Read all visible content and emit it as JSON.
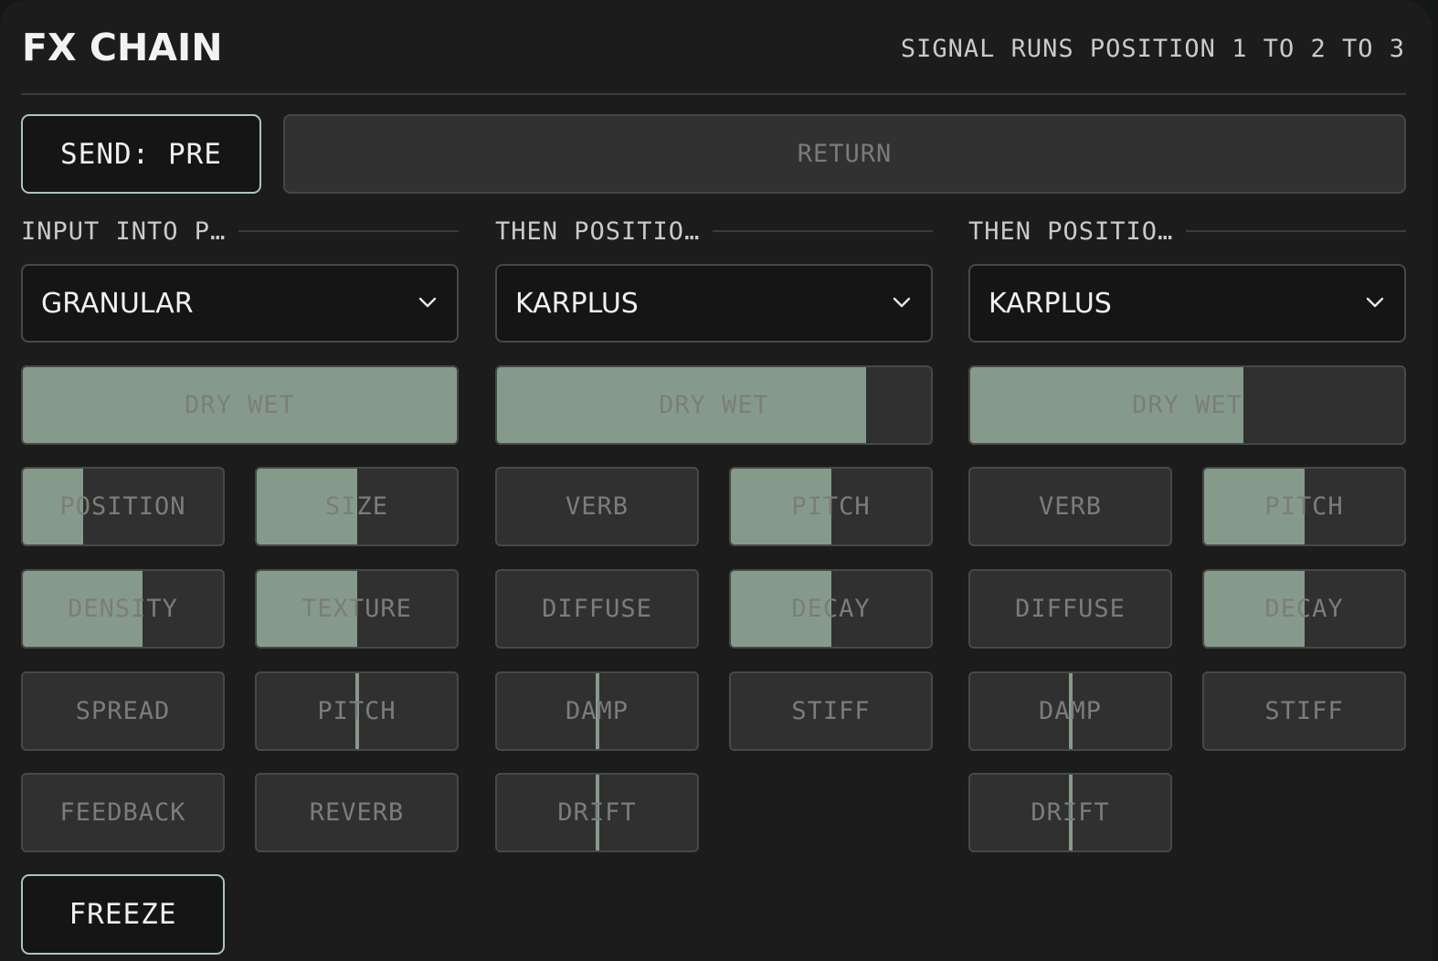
{
  "header": {
    "title": "FX CHAIN",
    "subtitle": "SIGNAL RUNS POSITION 1 TO 2 TO 3"
  },
  "send": {
    "label": "SEND: PRE"
  },
  "return": {
    "label": "RETURN"
  },
  "columns": [
    {
      "header": "INPUT INTO P…",
      "engine": "GRANULAR",
      "drywet": {
        "label": "DRY WET",
        "value": 1.0
      },
      "params": [
        {
          "label": "POSITION",
          "value": 0.3,
          "style": "fill"
        },
        {
          "label": "SIZE",
          "value": 0.5,
          "style": "fill"
        },
        {
          "label": "DENSITY",
          "value": 0.6,
          "style": "fill"
        },
        {
          "label": "TEXTURE",
          "value": 0.5,
          "style": "fill"
        },
        {
          "label": "SPREAD",
          "value": 0.0,
          "style": "fill"
        },
        {
          "label": "PITCH",
          "value": 0.5,
          "style": "center"
        },
        {
          "label": "FEEDBACK",
          "value": 0.0,
          "style": "fill"
        },
        {
          "label": "REVERB",
          "value": 0.0,
          "style": "fill"
        }
      ]
    },
    {
      "header": "THEN POSITIO…",
      "engine": "KARPLUS",
      "drywet": {
        "label": "DRY WET",
        "value": 0.85
      },
      "params": [
        {
          "label": "VERB",
          "value": 0.0,
          "style": "fill"
        },
        {
          "label": "PITCH",
          "value": 0.5,
          "style": "fill"
        },
        {
          "label": "DIFFUSE",
          "value": 0.0,
          "style": "fill"
        },
        {
          "label": "DECAY",
          "value": 0.5,
          "style": "fill"
        },
        {
          "label": "DAMP",
          "value": 0.5,
          "style": "center"
        },
        {
          "label": "STIFF",
          "value": 0.0,
          "style": "fill"
        },
        {
          "label": "DRIFT",
          "value": 0.5,
          "style": "center"
        }
      ]
    },
    {
      "header": "THEN POSITIO…",
      "engine": "KARPLUS",
      "drywet": {
        "label": "DRY WET",
        "value": 0.63
      },
      "params": [
        {
          "label": "VERB",
          "value": 0.0,
          "style": "fill"
        },
        {
          "label": "PITCH",
          "value": 0.5,
          "style": "fill"
        },
        {
          "label": "DIFFUSE",
          "value": 0.0,
          "style": "fill"
        },
        {
          "label": "DECAY",
          "value": 0.5,
          "style": "fill"
        },
        {
          "label": "DAMP",
          "value": 0.5,
          "style": "center"
        },
        {
          "label": "STIFF",
          "value": 0.0,
          "style": "fill"
        },
        {
          "label": "DRIFT",
          "value": 0.5,
          "style": "center"
        }
      ]
    }
  ],
  "freeze": {
    "label": "FREEZE"
  },
  "colors": {
    "accent": "#869a8c",
    "outline_active": "#a9c8b4",
    "panel": "#1b1c1b"
  }
}
